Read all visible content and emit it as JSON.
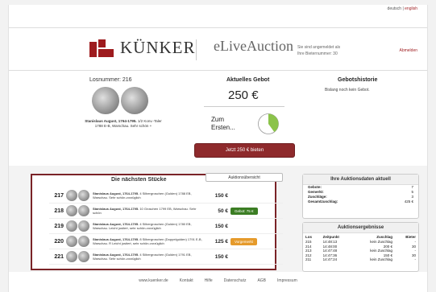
{
  "header": {
    "logo_text": "KÜNKER",
    "product": "eLiveAuction",
    "lang_de": "deutsch",
    "lang_sep": " | ",
    "lang_en": "english",
    "login_line1": "Sie sind angemeldet als",
    "login_line2": "Ihre Bieternummer: 30",
    "logout": "Abmelden"
  },
  "lot": {
    "number_label": "Losnummer: 216",
    "description_bold": "Stanislaus August, 1764-1795.",
    "description": " 1/2 Konv.-Taler 1788 E-B, Warschau. Sehr schön +"
  },
  "bid": {
    "label": "Aktuelles Gebot",
    "value": "250 €",
    "zum_line1": "Zum",
    "zum_line2": "Ersten...",
    "timer_fraction": 0.4,
    "button": "Jetzt 250 € bieten"
  },
  "history": {
    "label": "Gebotshistorie",
    "text": "Bislang noch kein Gebot."
  },
  "next": {
    "title": "Die nächsten Stücke",
    "overview_button": "Auktionsübersicht",
    "rows": [
      {
        "num": "217",
        "bold": "Stanislaus August, 1764-1795.",
        "text": " 4 Silbergroschen (Gulden) 1788 EB, Warschau. Sehr schön-vorzüglich",
        "price": "150 €",
        "badge": "",
        "badge_type": ""
      },
      {
        "num": "218",
        "bold": "Stanislaus August, 1764-1795.",
        "text": " 10 Groschen 1799 EB, Warschau. Sehr schön",
        "price": "50 €",
        "badge": "Gebot: 75 €",
        "badge_type": "green"
      },
      {
        "num": "219",
        "bold": "Stanislaus August, 1764-1795.",
        "text": " 4 Silbergroschen (Gulden) 1780 EB, Warschau. Leicht justiert, sehr schön-vorzüglich",
        "price": "150 €",
        "badge": "",
        "badge_type": ""
      },
      {
        "num": "220",
        "bold": "Stanislaus August, 1764-1795.",
        "text": " 8 Silbergroschen (Doppelgulden) 1791 E-B, Warschau. R Leicht justiert, sehr schön-vorzüglich",
        "price": "125 €",
        "badge": "Vorgemerkt",
        "badge_type": "orange"
      },
      {
        "num": "221",
        "bold": "Stanislaus August, 1764-1795.",
        "text": " 4 Silbergroschen (Gulden) 1791 EB, Warschau. Sehr schön-vorzüglich",
        "price": "150 €",
        "badge": "",
        "badge_type": ""
      }
    ]
  },
  "stats": {
    "title": "Ihre Auktionsdaten aktuell",
    "rows": [
      {
        "k": "Gebote:",
        "v": "7"
      },
      {
        "k": "Gemerkt:",
        "v": "5"
      },
      {
        "k": "Zuschläge:",
        "v": "3"
      },
      {
        "k": "Gesamtzuschlag:",
        "v": "425 €"
      }
    ]
  },
  "results": {
    "title": "Auktionsergebnisse",
    "headers": [
      "Los",
      "Zeitpunkt",
      "Zuschlag",
      "Bieter"
    ],
    "rows": [
      [
        "215",
        "14:48:13",
        "kein Zuschlag",
        "-"
      ],
      [
        "214",
        "14:48:00",
        "200 €",
        "30"
      ],
      [
        "213",
        "14:47:48",
        "kein Zuschlag",
        "-"
      ],
      [
        "212",
        "14:47:36",
        "150 €",
        "30"
      ],
      [
        "211",
        "14:47:24",
        "kein Zuschlag",
        "-"
      ]
    ]
  },
  "footer": [
    "www.kuenker.de",
    "Kontakt",
    "Hilfe",
    "Datenschutz",
    "AGB",
    "Impressum"
  ],
  "colors": {
    "brand": "#9e1b1e",
    "timer": "#8bc34a",
    "badge_green": "#3b7d23",
    "badge_orange": "#e59a2b"
  }
}
